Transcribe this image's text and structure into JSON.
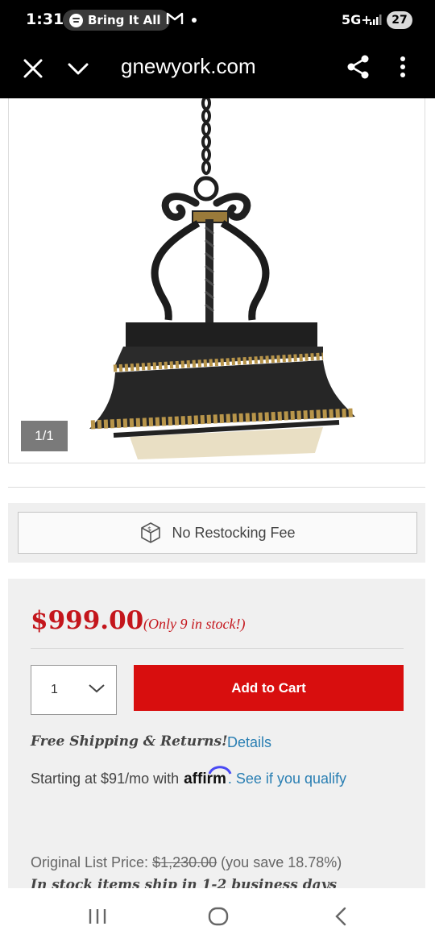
{
  "status_bar": {
    "time": "1:31",
    "media_pill": "Bring It All",
    "network": "5G+",
    "battery": "27",
    "icons": [
      "spotify-icon",
      "gmail-icon",
      "signal-icon"
    ]
  },
  "browser": {
    "url": "gnewyork.com",
    "icons": [
      "close-icon",
      "chevron-down-icon",
      "share-icon",
      "more-vert-icon"
    ]
  },
  "gallery": {
    "counter": "1/1"
  },
  "restock": {
    "label": "No Restocking Fee",
    "icon": "box-dollar-icon"
  },
  "purchase": {
    "price": "$999.00",
    "stock_note": "(Only 9 in stock!)",
    "quantity": "1",
    "add_to_cart": "Add to Cart",
    "shipping": "Free Shipping & Returns!",
    "details_link": "Details",
    "financing_text": "Starting at $91/mo with",
    "affirm": "affirm",
    "qualify_link": ". See if you qualify",
    "list_price_label": "Original List Price:",
    "list_price_value": "$1,230.00",
    "savings": "(you save 18.78%)",
    "ship_note": "In stock items ship in 1-2 business days"
  },
  "colors": {
    "brand_red": "#d80e0e",
    "price_red": "#c4161c",
    "link_blue": "#2a7fb3"
  }
}
